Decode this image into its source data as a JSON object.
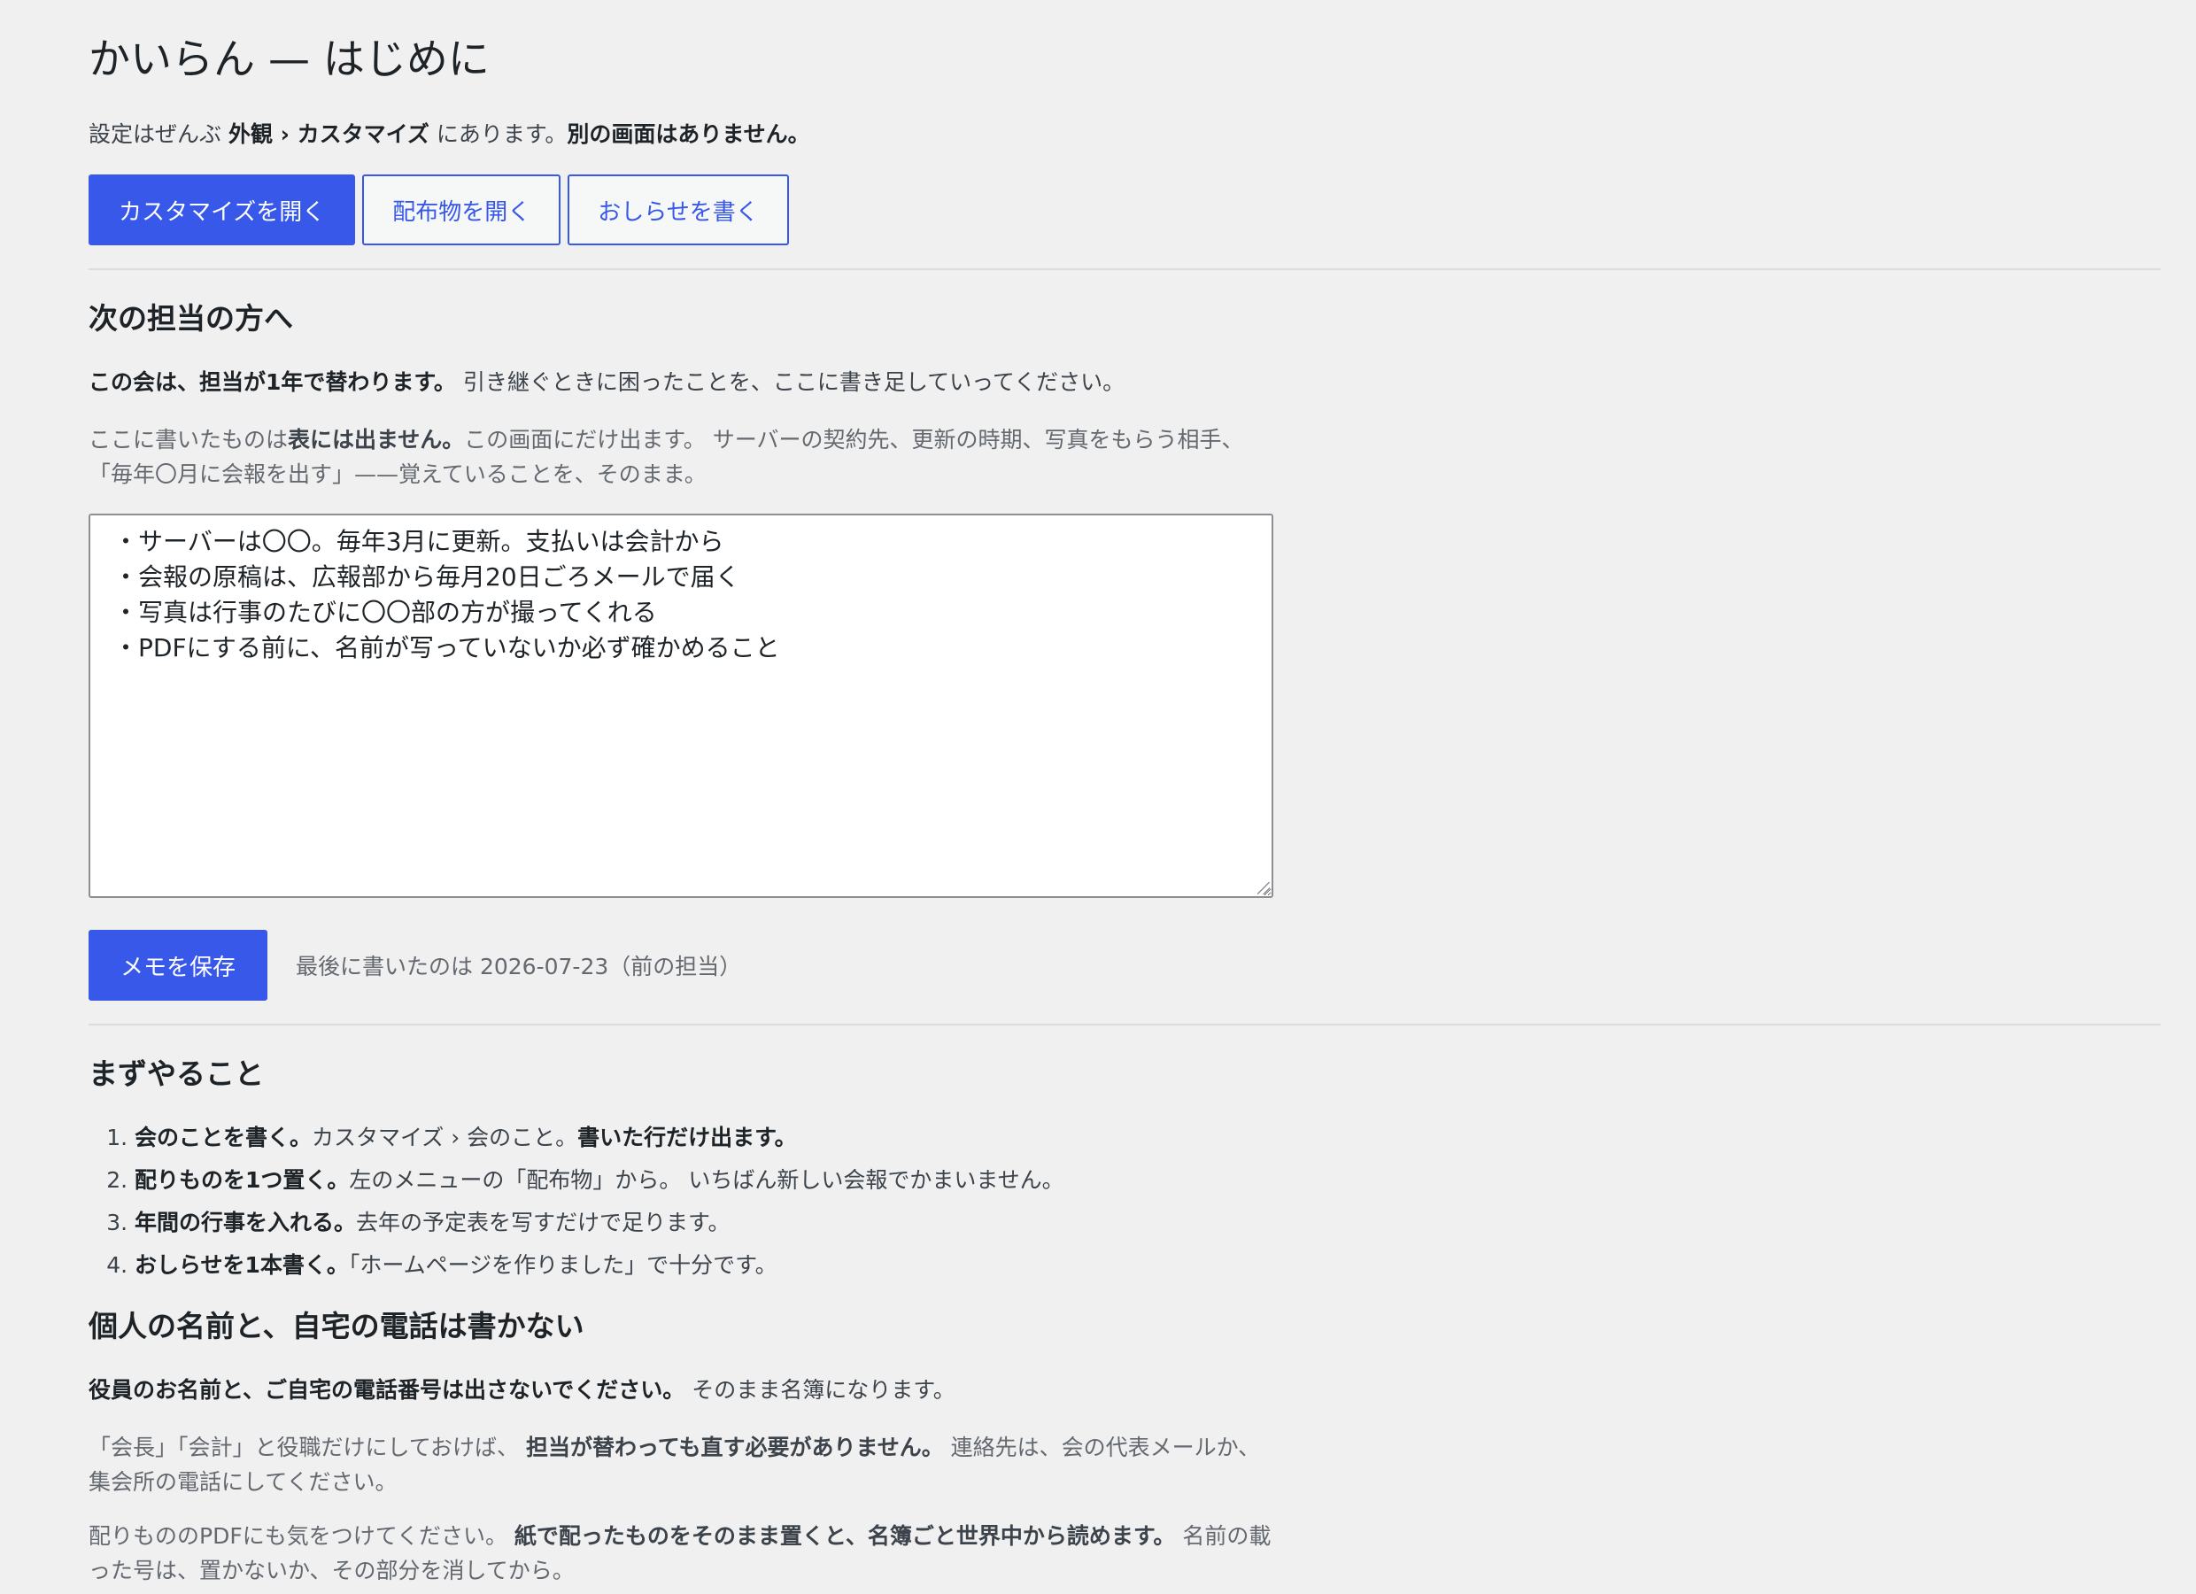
{
  "page": {
    "title": "かいらん — はじめに",
    "intro": {
      "prefix": "設定はぜんぶ ",
      "path_strong": "外観 › カスタマイズ",
      "middle": " にあります。",
      "tail_strong": "別の画面はありません。"
    },
    "actions": {
      "customize": "カスタマイズを開く",
      "handouts": "配布物を開く",
      "news": "おしらせを書く"
    }
  },
  "handover": {
    "heading": "次の担当の方へ",
    "lead_strong": "この会は、担当が1年で替わります。",
    "lead_rest": " 引き継ぐときに困ったことを、ここに書き足していってください。",
    "note_prefix": "ここに書いたものは",
    "note_strong": "表には出ません。",
    "note_rest": "この画面にだけ出ます。 サーバーの契約先、更新の時期、写真をもらう相手、 「毎年〇月に会報を出す」——覚えていることを、そのまま。",
    "memo": "・サーバーは〇〇。毎年3月に更新。支払いは会計から\n・会報の原稿は、広報部から毎月20日ごろメールで届く\n・写真は行事のたびに〇〇部の方が撮ってくれる\n・PDFにする前に、名前が写っていないか必ず確かめること",
    "save_label": "メモを保存",
    "last_saved": "最後に書いたのは 2026-07-23（前の担当）"
  },
  "first_steps": {
    "heading": "まずやること",
    "items": [
      {
        "num": "1.",
        "strong": "会のことを書く。",
        "rest": "カスタマイズ › 会のこと。",
        "strong2": "書いた行だけ出ます。"
      },
      {
        "num": "2.",
        "strong": "配りものを1つ置く。",
        "rest": "左のメニューの「配布物」から。 いちばん新しい会報でかまいません。",
        "strong2": ""
      },
      {
        "num": "3.",
        "strong": "年間の行事を入れる。",
        "rest": "去年の予定表を写すだけで足ります。",
        "strong2": ""
      },
      {
        "num": "4.",
        "strong": "おしらせを1本書く。",
        "rest": "「ホームページを作りました」で十分です。",
        "strong2": ""
      }
    ]
  },
  "privacy": {
    "heading": "個人の名前と、自宅の電話は書かない",
    "p1_strong": "役員のお名前と、ご自宅の電話番号は出さないでください。",
    "p1_rest": " そのまま名簿になります。",
    "p2_prefix": "「会長」「会計」と役職だけにしておけば、 ",
    "p2_strong": "担当が替わっても直す必要がありません。",
    "p2_rest": " 連絡先は、会の代表メールか、集会所の電話にしてください。",
    "p3_prefix": "配りもののPDFにも気をつけてください。 ",
    "p3_strong": "紙で配ったものをそのまま置くと、名簿ごと世界中から読めます。",
    "p3_rest": " 名前の載った号は、置かないか、その部分を消してから。"
  }
}
